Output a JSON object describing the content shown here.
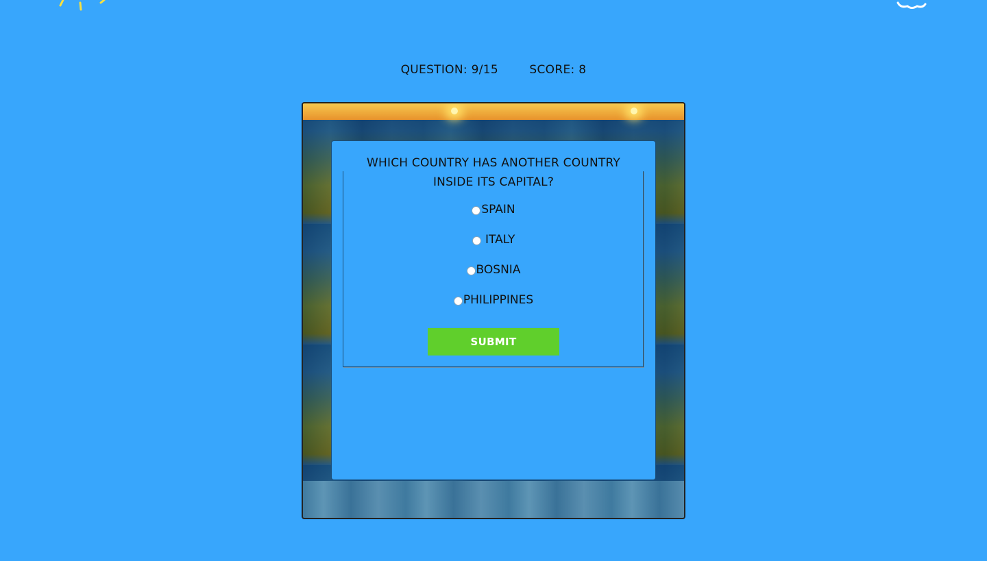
{
  "status": {
    "question_label": "QUESTION: 9/15",
    "score_label": "SCORE: 8"
  },
  "quiz": {
    "question": "WHICH COUNTRY HAS ANOTHER COUNTRY INSIDE ITS CAPITAL?",
    "options": [
      {
        "label": "SPAIN"
      },
      {
        "label": "ITALY"
      },
      {
        "label": "BOSNIA"
      },
      {
        "label": "PHILIPPINES"
      }
    ],
    "submit_label": "SUBMIT"
  },
  "colors": {
    "background": "#38a6fc",
    "submit_button": "#60cf2c"
  },
  "decorations": [
    "sun-icon",
    "cloud-icon"
  ]
}
